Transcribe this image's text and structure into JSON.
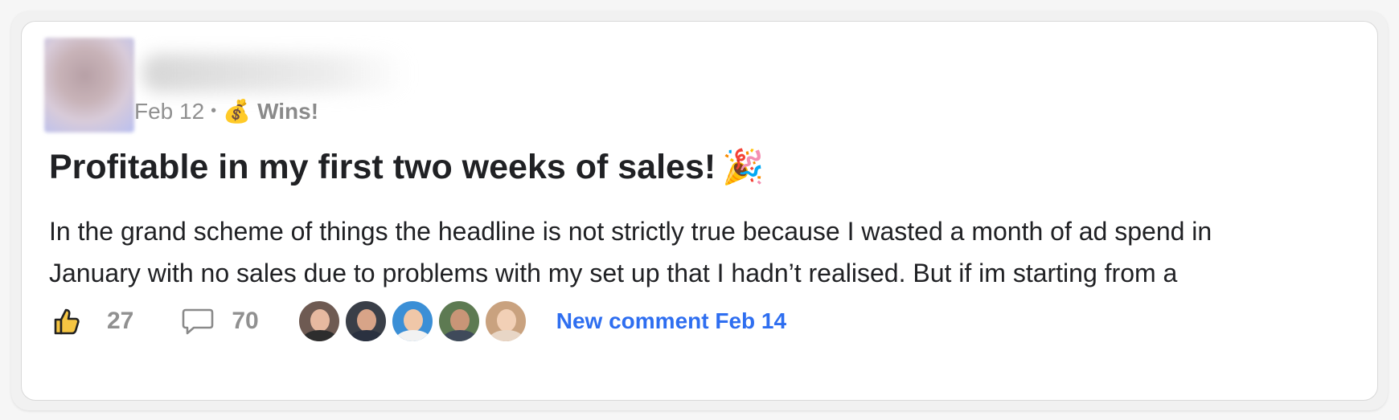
{
  "post": {
    "date": "Feb 12",
    "separator": "•",
    "category_icon": "money-bag-icon",
    "category_emoji": "💰",
    "category_label": "Wins!",
    "title": "Profitable in my first two weeks of sales!",
    "title_emoji": "🎉",
    "title_emoji_icon": "party-popper-icon",
    "body_lines": [
      "In the grand scheme of things the headline is not strictly true because I wasted a month of ad spend in",
      "January with no sales due to problems with my set up that I hadn’t realised. But if im starting from a"
    ]
  },
  "actions": {
    "like_count": "27",
    "comment_count": "70",
    "new_comment_label": "New comment Feb 14"
  },
  "commenter_avatars": [
    {
      "icon": "commenter-avatar-1"
    },
    {
      "icon": "commenter-avatar-2"
    },
    {
      "icon": "commenter-avatar-3"
    },
    {
      "icon": "commenter-avatar-4"
    },
    {
      "icon": "commenter-avatar-5"
    }
  ],
  "colors": {
    "accent_blue": "#2e6ef0",
    "muted_gray": "#909090",
    "text_dark": "#202124",
    "like_yellow": "#f5c542"
  }
}
